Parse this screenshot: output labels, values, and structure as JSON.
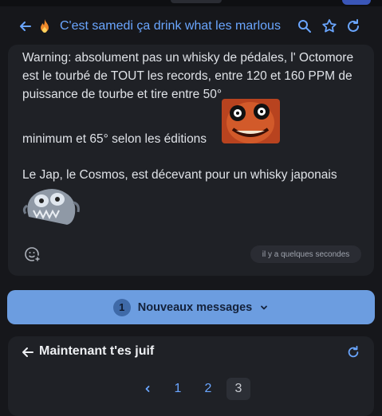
{
  "topic": {
    "title": "C'est samedi ça drink what les marlous"
  },
  "post": {
    "paragraph1": "Warning: absolument pas un whisky de pédales, l' Octomore est le tourbé de TOUT les records, entre 120 et 160 PPM de puissance de tourbe et tire entre 50°",
    "paragraph2": "minimum et 65° selon les éditions",
    "paragraph3": "Le Jap, le Cosmos, est décevant pour un whisky japonais",
    "timestamp": "il y a quelques secondes"
  },
  "new_messages": {
    "count": "1",
    "label": "Nouveaux messages"
  },
  "next_topic": {
    "title": "Maintenant t'es juif",
    "pages": [
      "1",
      "2",
      "3"
    ],
    "current_page": "3"
  },
  "colors": {
    "accent": "#6aa6ff",
    "banner": "#6c9de0",
    "card": "#1f2126",
    "background": "#16171b"
  }
}
